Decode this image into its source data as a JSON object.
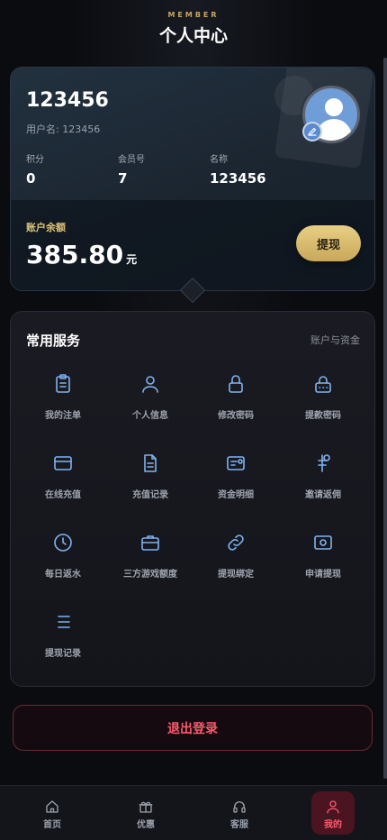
{
  "header": {
    "eyebrow": "MEMBER",
    "title": "个人中心"
  },
  "account": {
    "id": "123456",
    "username_text": "用户名: 123456",
    "stats": [
      {
        "label": "积分",
        "value": "0"
      },
      {
        "label": "会员号",
        "value": "7"
      },
      {
        "label": "名称",
        "value": "123456"
      }
    ],
    "balance_label": "账户余额",
    "balance_value": "385.80",
    "balance_unit": "元",
    "withdraw_label": "提现"
  },
  "services": {
    "title": "常用服务",
    "link": "账户与资金",
    "items": [
      {
        "label": "我的注单",
        "icon": "clipboard-icon"
      },
      {
        "label": "个人信息",
        "icon": "user-icon"
      },
      {
        "label": "修改密码",
        "icon": "lock-icon"
      },
      {
        "label": "提款密码",
        "icon": "lock-keypad-icon"
      },
      {
        "label": "在线充值",
        "icon": "credit-card-icon"
      },
      {
        "label": "充值记录",
        "icon": "document-icon"
      },
      {
        "label": "资金明细",
        "icon": "wallet-detail-icon"
      },
      {
        "label": "邀请返佣",
        "icon": "commission-icon"
      },
      {
        "label": "每日返水",
        "icon": "clock-icon"
      },
      {
        "label": "三方游戏额度",
        "icon": "briefcase-icon"
      },
      {
        "label": "提现绑定",
        "icon": "link-icon"
      },
      {
        "label": "申请提现",
        "icon": "cash-icon"
      },
      {
        "label": "提现记录",
        "icon": "list-icon"
      }
    ]
  },
  "logout_label": "退出登录",
  "tabs": [
    {
      "label": "首页",
      "icon": "home-icon"
    },
    {
      "label": "优惠",
      "icon": "gift-icon"
    },
    {
      "label": "客服",
      "icon": "headset-icon"
    },
    {
      "label": "我的",
      "icon": "user-icon",
      "active": true
    }
  ],
  "colors": {
    "accent_gold": "#e0c27a",
    "danger": "#ff5a6e",
    "icon_blue": "#7fb3f0"
  }
}
